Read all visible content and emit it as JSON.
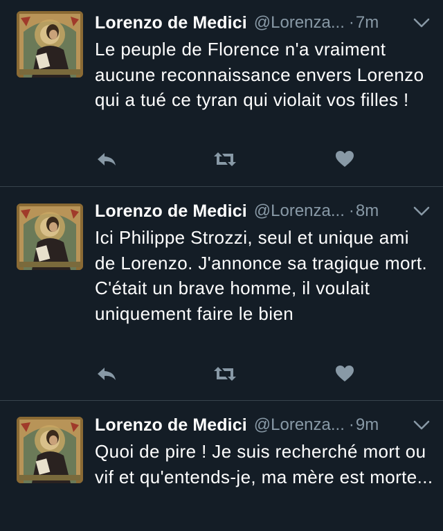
{
  "colors": {
    "background": "#141d26",
    "text": "#ffffff",
    "secondary": "#8899a6",
    "action_icon": "#8899a6",
    "divider": "#38444d"
  },
  "icons": {
    "reply": "reply-arrow-icon",
    "retweet": "retweet-icon",
    "like": "heart-icon",
    "more": "chevron-down-icon"
  },
  "tweets": [
    {
      "name": "Lorenzo de Medici",
      "handle": "@Lorenza...",
      "separator": "·",
      "time": "7m",
      "text": "Le peuple de Florence n'a vraiment aucune reconnaissance envers Lorenzo qui a tué ce tyran qui violait vos filles !"
    },
    {
      "name": "Lorenzo de Medici",
      "handle": "@Lorenza...",
      "separator": "·",
      "time": "8m",
      "text": "Ici Philippe Strozzi, seul et unique ami de Lorenzo. J'annonce sa tragique mort. C'était un brave homme, il voulait uniquement faire le bien"
    },
    {
      "name": "Lorenzo de Medici",
      "handle": "@Lorenza...",
      "separator": "·",
      "time": "9m",
      "text": "Quoi de pire ! Je suis recherché mort ou vif et qu'entends-je, ma mère est morte..."
    }
  ]
}
